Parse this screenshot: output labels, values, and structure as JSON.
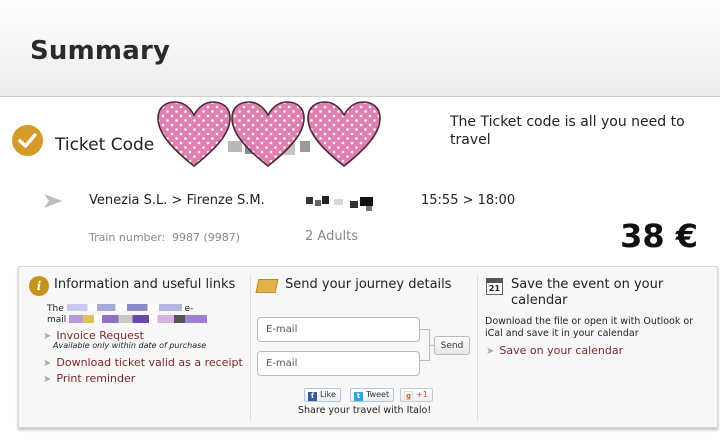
{
  "page": {
    "title": "Summary"
  },
  "ticket": {
    "label": "Ticket Code",
    "note": "The Ticket code is all you need to travel"
  },
  "journey": {
    "route": "Venezia S.L. > Firenze S.M.",
    "times": "15:55 > 18:00",
    "train_label": "Train number:",
    "train_value": "9987 (9987)",
    "passengers": "2 Adults",
    "price": "38 €"
  },
  "info": {
    "title": "Information and useful links",
    "text_prefix": "The",
    "text_line2": "mail",
    "links": [
      {
        "label": "Invoice Request"
      },
      {
        "label": "Download ticket valid as a receipt"
      },
      {
        "label": "Print reminder"
      }
    ],
    "invoice_sub": "Available only within date of purchase"
  },
  "share": {
    "title": "Send your journey details",
    "email_placeholder_1": "E-mail",
    "email_placeholder_2": "E-mail",
    "send_label": "Send",
    "facebook_label": "Like",
    "twitter_label": "Tweet",
    "gplus_label": "+1",
    "footer": "Share your travel with Italo!"
  },
  "calendar": {
    "icon_day": "21",
    "title": "Save the event on your calendar",
    "description": "Download the file or open it with Outlook or iCal and save it in your calendar",
    "link": "Save on your calendar"
  },
  "icons": {
    "check": "check-circle-icon",
    "route_arrow": "arrow-right-icon",
    "info": "info-icon",
    "mail": "envelope-icon",
    "calendar": "calendar-icon",
    "facebook": "facebook-icon",
    "twitter": "twitter-icon",
    "gplus": "google-plus-icon"
  },
  "colors": {
    "accent_gold": "#d49a2a",
    "link": "#7a2a2a",
    "heart_pink": "#e07fb1"
  }
}
